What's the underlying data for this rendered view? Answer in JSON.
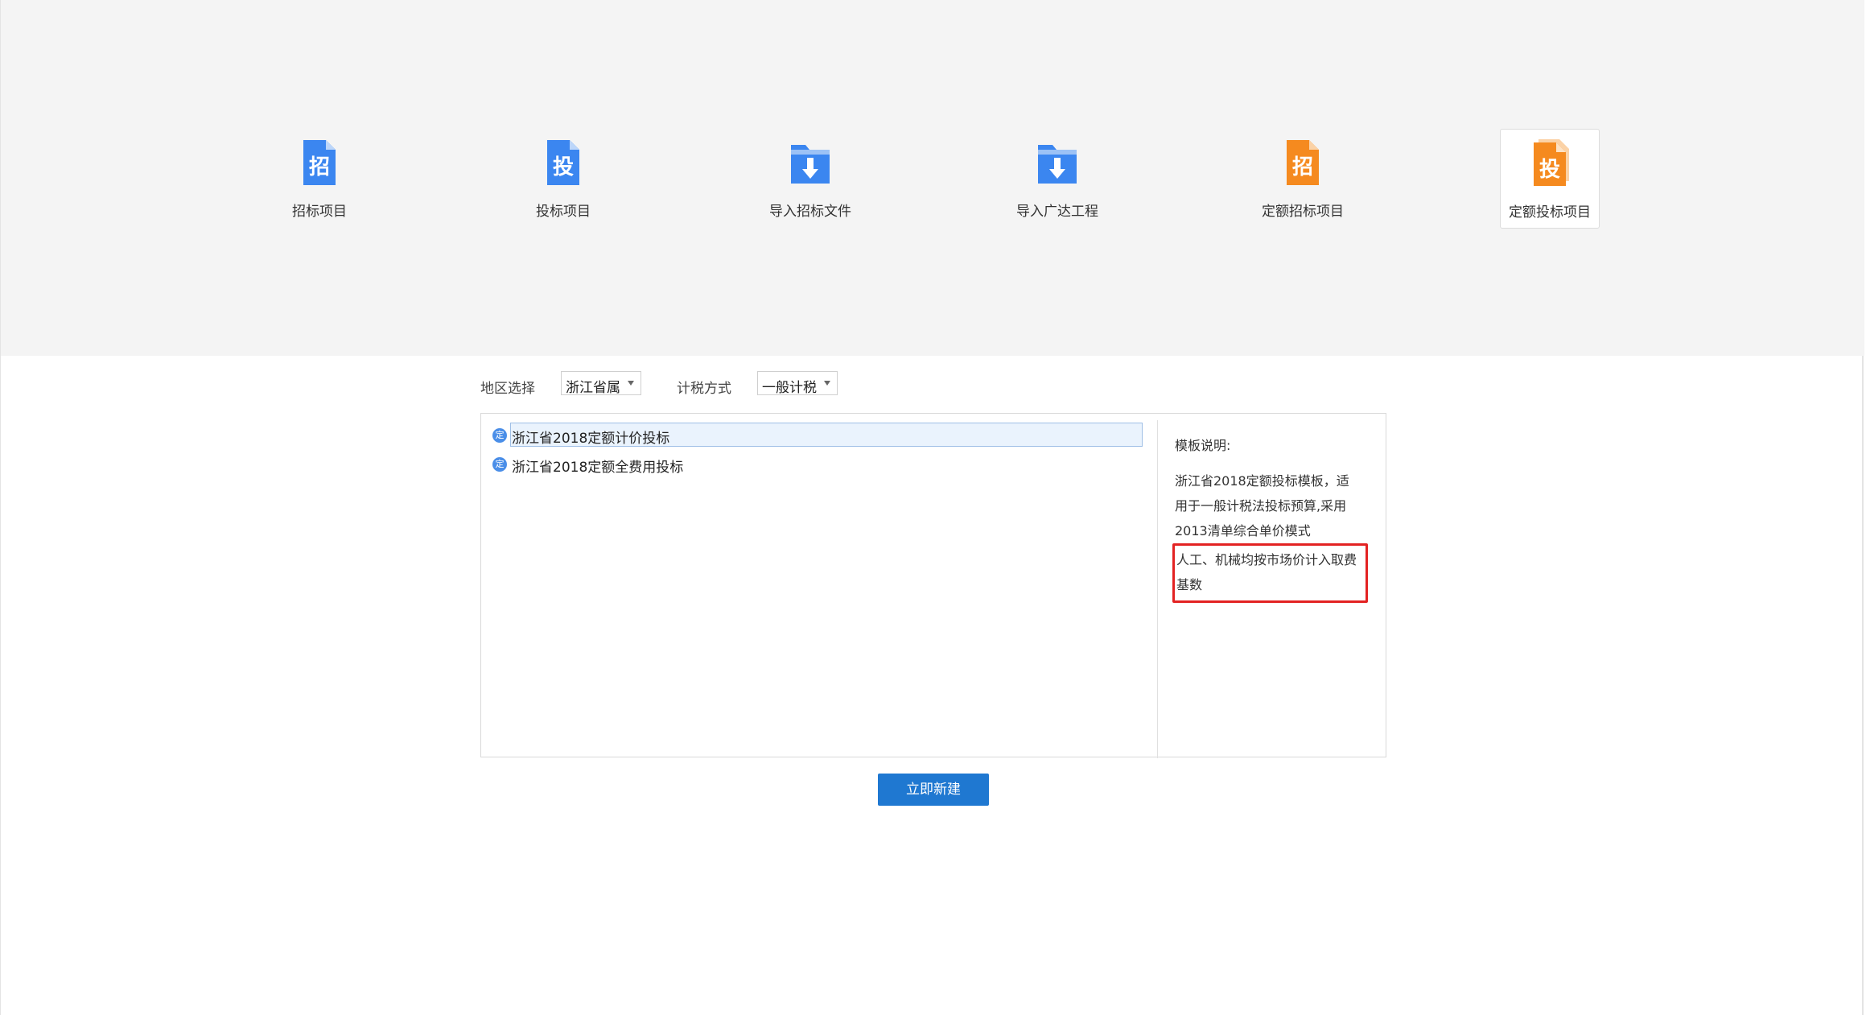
{
  "toolbar": {
    "tiles": [
      {
        "label": "招标项目",
        "glyph": "招",
        "icon": "zhao-document-icon",
        "color": "#3b86f0"
      },
      {
        "label": "投标项目",
        "glyph": "投",
        "icon": "tou-document-icon",
        "color": "#3b86f0"
      },
      {
        "label": "导入招标文件",
        "icon": "import-folder-icon",
        "color": "#3b86f0"
      },
      {
        "label": "导入广达工程",
        "icon": "import-folder-icon",
        "color": "#3b86f0"
      },
      {
        "label": "定额招标项目",
        "glyph": "招",
        "icon": "zhao-quota-document-icon",
        "color": "#f58a1f"
      },
      {
        "label": "定额投标项目",
        "glyph": "投",
        "icon": "tou-quota-document-icon",
        "color": "#f58a1f",
        "selected": true
      }
    ]
  },
  "filters": {
    "region_label": "地区选择",
    "region_value": "浙江省属",
    "tax_label": "计税方式",
    "tax_value": "一般计税"
  },
  "templates": {
    "items": [
      {
        "label": "浙江省2018定额计价投标",
        "icon": "quota-globe-icon",
        "glyph": "定",
        "selected": true
      },
      {
        "label": "浙江省2018定额全费用投标",
        "icon": "quota-globe-icon",
        "glyph": "定",
        "selected": false
      }
    ]
  },
  "description": {
    "title": "模板说明:",
    "lines": [
      "浙江省2018定额投标模板，适",
      "用于一般计税法投标预算,采用",
      "2013清单综合单价模式"
    ],
    "highlighted_lines": [
      "人工、机械均按市场价计入取费",
      "基数"
    ],
    "highlight_color": "#e32222"
  },
  "actions": {
    "create_label": "立即新建",
    "create_color": "#1f78d1"
  }
}
